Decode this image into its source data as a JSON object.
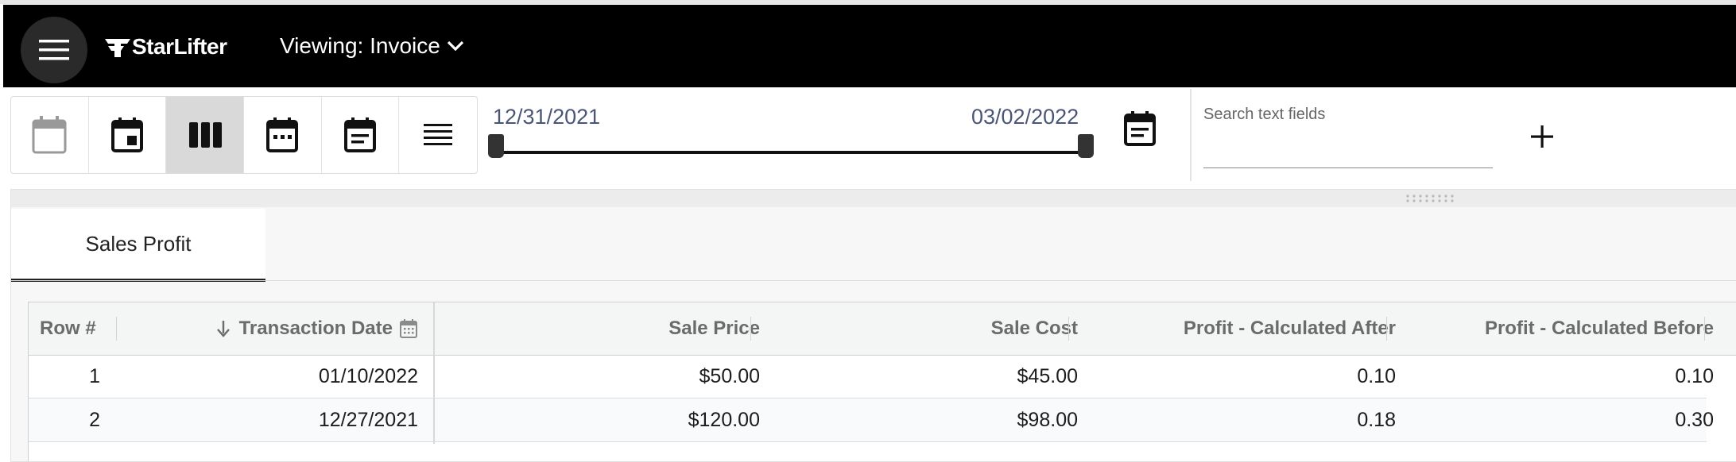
{
  "app": {
    "brand": "StarLifter",
    "viewing_label": "Viewing: Invoice",
    "icons": {
      "menu": "hamburger-icon",
      "logo": "starlifter-logo",
      "dropdown": "chevron-down-icon"
    }
  },
  "toolbar": {
    "buttons": [
      {
        "name": "calendar-outline-icon",
        "active": false
      },
      {
        "name": "calendar-day-icon",
        "active": false
      },
      {
        "name": "columns-view-icon",
        "active": true
      },
      {
        "name": "calendar-week-icon",
        "active": false
      },
      {
        "name": "calendar-agenda-icon",
        "active": false
      },
      {
        "name": "list-view-icon",
        "active": false
      }
    ]
  },
  "date_range": {
    "start": "12/31/2021",
    "end": "03/02/2022",
    "calendar_icon": "calendar-event-icon"
  },
  "search": {
    "label": "Search text fields",
    "value": "",
    "add_icon": "plus-icon"
  },
  "tabs": [
    {
      "label": "Sales Profit",
      "active": true
    }
  ],
  "grid": {
    "columns": [
      {
        "label": "Row #"
      },
      {
        "label": "Transaction Date",
        "sort": "descending",
        "sort_icon": "arrow-down-icon",
        "type_icon": "calendar-icon"
      },
      {
        "label": "Sale Price"
      },
      {
        "label": "Sale Cost"
      },
      {
        "label": "Profit - Calculated After"
      },
      {
        "label": "Profit - Calculated Before"
      }
    ],
    "rows": [
      {
        "row_num": "1",
        "transaction_date": "01/10/2022",
        "sale_price": "$50.00",
        "sale_cost": "$45.00",
        "profit_after": "0.10",
        "profit_before": "0.10"
      },
      {
        "row_num": "2",
        "transaction_date": "12/27/2021",
        "sale_price": "$120.00",
        "sale_cost": "$98.00",
        "profit_after": "0.18",
        "profit_before": "0.30"
      }
    ]
  },
  "colors": {
    "appbar_bg": "#000000",
    "active_toolbar_bg": "#d9d9d9",
    "date_text": "#4a5678",
    "header_text": "#6b6b6b"
  }
}
